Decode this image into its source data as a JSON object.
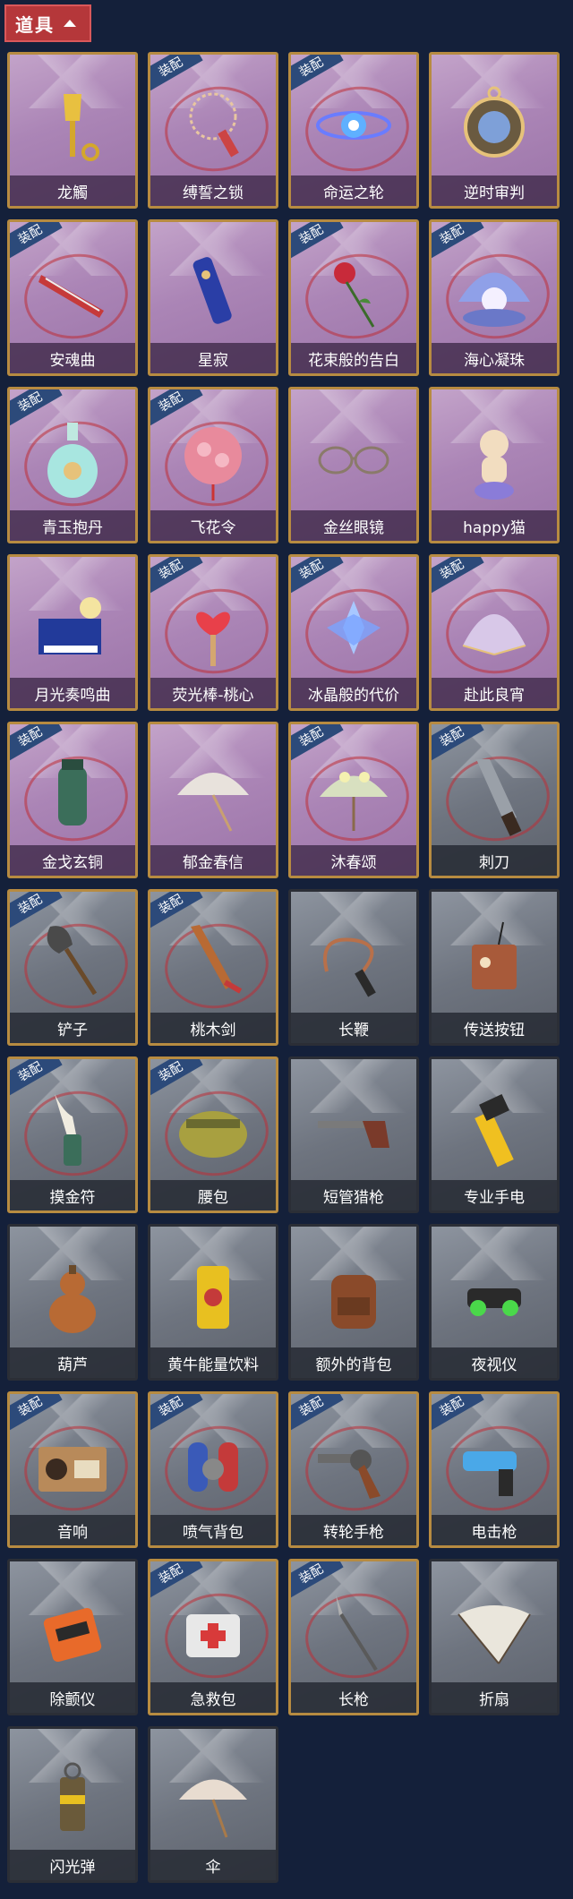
{
  "header": {
    "title": "道具"
  },
  "badge_text": "装配",
  "colors": {
    "header_bg": "#b5373a",
    "purple_card": "#ab85b6",
    "grey_card": "#6e747f",
    "badge_bg": "#2c4a7a",
    "gold_frame": "#b78b41"
  },
  "items": [
    {
      "name": "龙觸",
      "style": "purple",
      "equipped": false,
      "icon": "golden-shovel-icon"
    },
    {
      "name": "缚誓之锁",
      "style": "purple",
      "equipped": true,
      "icon": "chain-lock-icon"
    },
    {
      "name": "命运之轮",
      "style": "purple",
      "equipped": true,
      "icon": "wheel-of-fate-icon"
    },
    {
      "name": "逆时审判",
      "style": "purple",
      "equipped": false,
      "icon": "pocket-watch-icon"
    },
    {
      "name": "安魂曲",
      "style": "purple",
      "equipped": true,
      "icon": "red-blade-icon"
    },
    {
      "name": "星寂",
      "style": "purple",
      "equipped": false,
      "icon": "star-telescope-icon"
    },
    {
      "name": "花束般的告白",
      "style": "purple",
      "equipped": true,
      "icon": "rose-icon"
    },
    {
      "name": "海心凝珠",
      "style": "purple",
      "equipped": true,
      "icon": "pearl-shell-icon"
    },
    {
      "name": "青玉抱丹",
      "style": "purple",
      "equipped": true,
      "icon": "jade-bottle-icon"
    },
    {
      "name": "飞花令",
      "style": "purple",
      "equipped": true,
      "icon": "flower-ball-icon"
    },
    {
      "name": "金丝眼镜",
      "style": "purple",
      "equipped": false,
      "icon": "glasses-icon"
    },
    {
      "name": "happy猫",
      "style": "purple",
      "equipped": false,
      "icon": "cat-figure-icon"
    },
    {
      "name": "月光奏鸣曲",
      "style": "purple",
      "equipped": false,
      "icon": "piano-icon"
    },
    {
      "name": "荧光棒-桃心",
      "style": "purple",
      "equipped": true,
      "icon": "heart-wand-icon"
    },
    {
      "name": "冰晶般的代价",
      "style": "purple",
      "equipped": true,
      "icon": "crystal-lotus-icon"
    },
    {
      "name": "赴此良宵",
      "style": "purple",
      "equipped": true,
      "icon": "golden-fan-icon"
    },
    {
      "name": "金戈玄铜",
      "style": "purple",
      "equipped": true,
      "icon": "bronze-grenade-icon"
    },
    {
      "name": "郁金春信",
      "style": "purple",
      "equipped": false,
      "icon": "paper-umbrella-icon"
    },
    {
      "name": "沐春颂",
      "style": "purple",
      "equipped": true,
      "icon": "flower-umbrella-icon"
    },
    {
      "name": "刺刀",
      "style": "grey",
      "equipped": true,
      "icon": "knife-icon"
    },
    {
      "name": "铲子",
      "style": "grey",
      "equipped": true,
      "icon": "shovel-icon"
    },
    {
      "name": "桃木剑",
      "style": "grey",
      "equipped": true,
      "icon": "wooden-sword-icon"
    },
    {
      "name": "长鞭",
      "style": "grey",
      "equipped": false,
      "icon": "whip-icon"
    },
    {
      "name": "传送按钮",
      "style": "grey",
      "equipped": false,
      "icon": "teleport-button-icon"
    },
    {
      "name": "摸金符",
      "style": "grey",
      "equipped": true,
      "icon": "talisman-tooth-icon"
    },
    {
      "name": "腰包",
      "style": "grey",
      "equipped": true,
      "icon": "waist-bag-icon"
    },
    {
      "name": "短管猎枪",
      "style": "grey",
      "equipped": false,
      "icon": "shotgun-icon"
    },
    {
      "name": "专业手电",
      "style": "grey",
      "equipped": false,
      "icon": "flashlight-icon"
    },
    {
      "name": "葫芦",
      "style": "grey",
      "equipped": false,
      "icon": "gourd-icon"
    },
    {
      "name": "黄牛能量饮料",
      "style": "grey",
      "equipped": false,
      "icon": "energy-can-icon"
    },
    {
      "name": "额外的背包",
      "style": "grey",
      "equipped": false,
      "icon": "backpack-icon"
    },
    {
      "name": "夜视仪",
      "style": "grey",
      "equipped": false,
      "icon": "night-vision-icon"
    },
    {
      "name": "音响",
      "style": "grey",
      "equipped": true,
      "icon": "radio-icon"
    },
    {
      "name": "喷气背包",
      "style": "grey",
      "equipped": true,
      "icon": "jetpack-icon"
    },
    {
      "name": "转轮手枪",
      "style": "grey",
      "equipped": true,
      "icon": "revolver-icon"
    },
    {
      "name": "电击枪",
      "style": "grey",
      "equipped": true,
      "icon": "taser-icon"
    },
    {
      "name": "除颤仪",
      "style": "grey",
      "equipped": false,
      "icon": "defibrillator-icon"
    },
    {
      "name": "急救包",
      "style": "grey",
      "equipped": true,
      "icon": "first-aid-icon"
    },
    {
      "name": "长枪",
      "style": "grey",
      "equipped": true,
      "icon": "spear-icon"
    },
    {
      "name": "折扇",
      "style": "grey",
      "equipped": false,
      "icon": "folding-fan-icon"
    },
    {
      "name": "闪光弹",
      "style": "grey",
      "equipped": false,
      "icon": "flashbang-icon"
    },
    {
      "name": "伞",
      "style": "grey",
      "equipped": false,
      "icon": "umbrella-icon"
    }
  ]
}
